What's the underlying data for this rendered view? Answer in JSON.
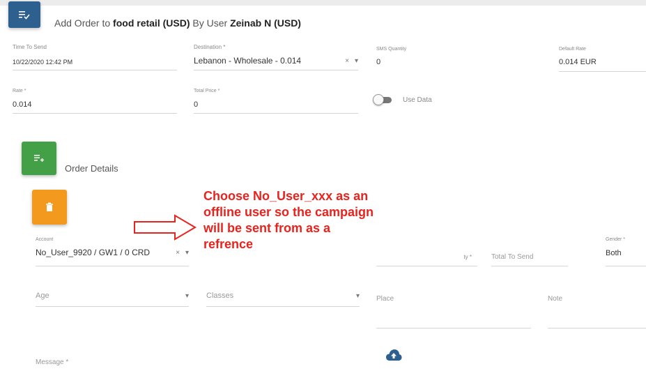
{
  "header": {
    "prefix": "Add Order to",
    "company": "food retail (USD)",
    "by": "By User",
    "user": "Zeinab N (USD)",
    "icon": "playlist-check-icon"
  },
  "fields": {
    "time_to_send": {
      "label": "Time To Send",
      "value": "10/22/2020 12:42 PM"
    },
    "destination": {
      "label": "Destination *",
      "value": "Lebanon - Wholesale - 0.014",
      "clear": "×",
      "caret": "▾"
    },
    "sms_quantity": {
      "label": "SMS Quantity",
      "value": "0"
    },
    "default_rate": {
      "label": "Default Rate",
      "value": "0.014 EUR"
    },
    "rate": {
      "label": "Rate *",
      "value": "0.014"
    },
    "total_price": {
      "label": "Total Price *",
      "value": "0"
    },
    "use_data": {
      "label": "Use Data",
      "on": false
    }
  },
  "order_details": {
    "title": "Order Details",
    "icon": "playlist-add-icon",
    "delete_icon": "trash-icon",
    "account": {
      "label": "Account",
      "value": "No_User_9920 / GW1 / 0 CRD",
      "clear": "×",
      "caret": "▾"
    },
    "quantity": {
      "label": "ty *"
    },
    "total_to_send": {
      "placeholder": "Total To Send"
    },
    "gender": {
      "label": "Gender *",
      "value": "Both"
    },
    "age": {
      "placeholder": "Age",
      "caret": "▾"
    },
    "classes": {
      "placeholder": "Classes",
      "caret": "▾"
    },
    "place": {
      "placeholder": "Place"
    },
    "note": {
      "placeholder": "Note"
    },
    "message": {
      "placeholder": "Message *"
    },
    "upload_icon": "cloud-upload-icon"
  },
  "annotation": {
    "text": "Choose No_User_xxx as an\noffline user so the campaign\nwill be sent from as a\nrefrence",
    "color": "#e8231d"
  },
  "colors": {
    "main_tile": "#2d5f8f",
    "details_tile": "#43a047",
    "delete_tile": "#f39a1e"
  }
}
